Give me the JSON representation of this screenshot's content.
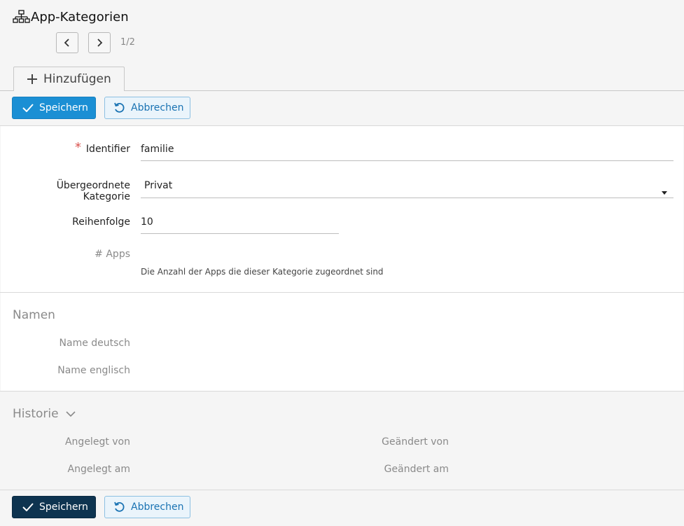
{
  "header": {
    "title": "App-Kategorien",
    "pager": "1/2"
  },
  "tab": {
    "label": "Hinzufügen"
  },
  "actions": {
    "save_label": "Speichern",
    "cancel_label": "Abbrechen"
  },
  "form": {
    "identifier": {
      "label": "Identifier",
      "value": "familie",
      "required_mark": "*"
    },
    "parent": {
      "label": "Übergeordnete Kategorie",
      "value": "Privat"
    },
    "order": {
      "label": "Reihenfolge",
      "value": "10"
    },
    "apps": {
      "label": "# Apps",
      "hint": "Die Anzahl der Apps die dieser Kategorie zugeordnet sind"
    }
  },
  "names": {
    "title": "Namen",
    "german_label": "Name deutsch",
    "english_label": "Name englisch"
  },
  "history": {
    "title": "Historie",
    "created_by_label": "Angelegt von",
    "created_at_label": "Angelegt am",
    "modified_by_label": "Geändert von",
    "modified_at_label": "Geändert am"
  },
  "colors": {
    "primary": "#1b8fd4",
    "primary_dark": "#0e3450",
    "cancel_text": "#1a73b3",
    "required": "#d9534f"
  }
}
